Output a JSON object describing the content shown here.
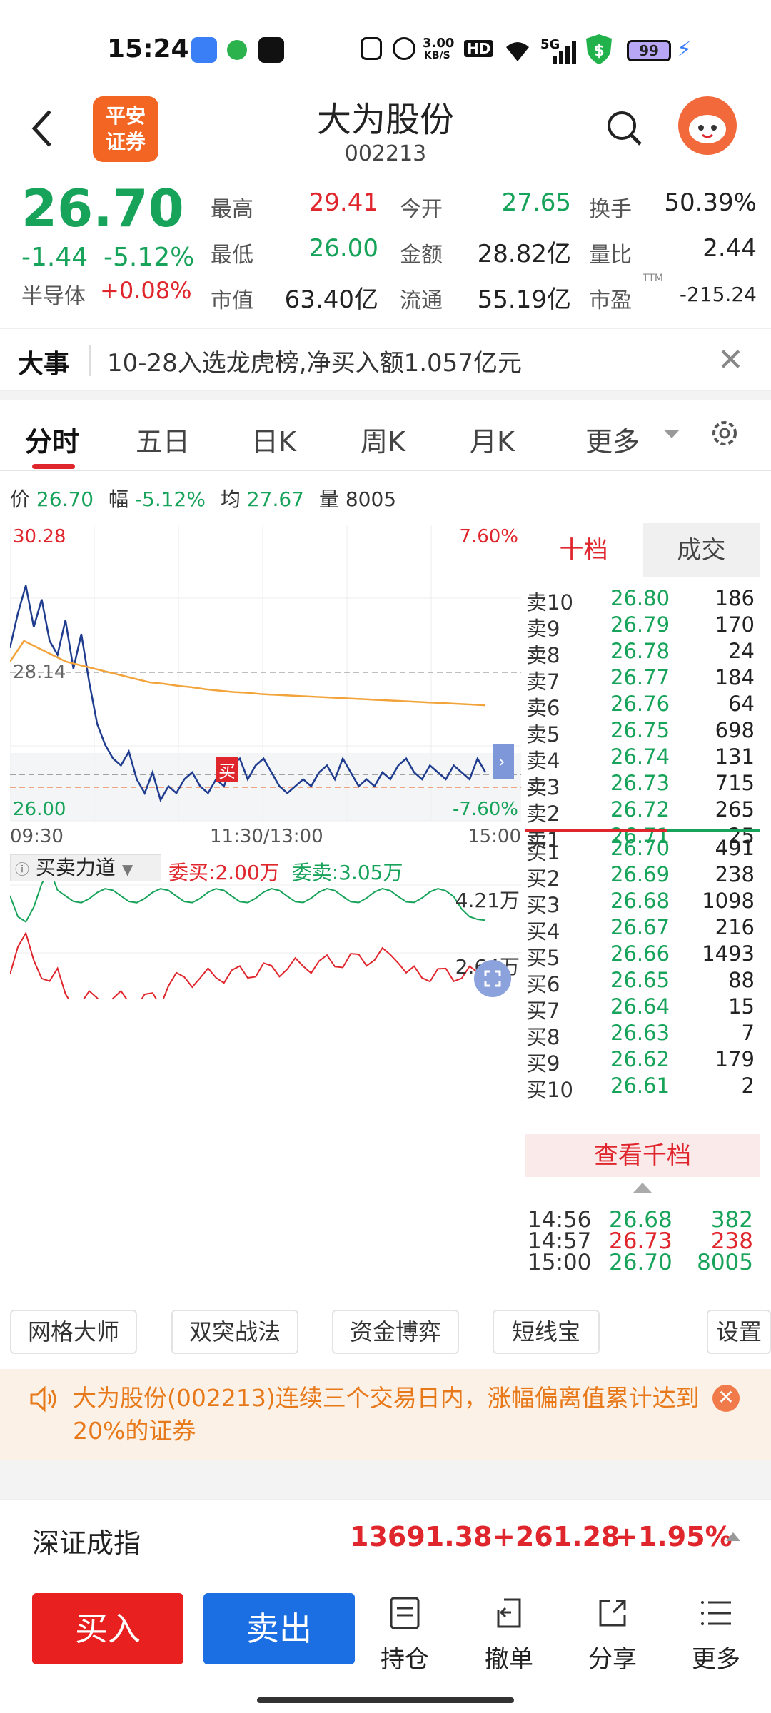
{
  "status_bar": {
    "time": "15:24",
    "net_speed_value": "3.00",
    "net_speed_unit": "KB/S",
    "hd": "HD",
    "signal": "5G",
    "battery": "99"
  },
  "header": {
    "logo_line1": "平安",
    "logo_line2": "证券",
    "stock_name": "大为股份",
    "stock_code": "002213"
  },
  "quote": {
    "price": "26.70",
    "change": "-1.44",
    "change_pct": "-5.12%",
    "sector_label": "半导体",
    "sector_pct": "+0.08%",
    "high_label": "最高",
    "high": "29.41",
    "low_label": "最低",
    "low": "26.00",
    "mcap_label": "市值",
    "mcap": "63.40亿",
    "open_label": "今开",
    "open": "27.65",
    "amount_label": "金额",
    "amount": "28.82亿",
    "float_label": "流通",
    "float": "55.19亿",
    "turnover_label": "换手",
    "turnover": "50.39%",
    "vol_ratio_label": "量比",
    "vol_ratio": "2.44",
    "pe_label": "市盈",
    "pe_sup": "TTM",
    "pe": "-215.24"
  },
  "news": {
    "tag": "大事",
    "text": "10-28入选龙虎榜,净买入额1.057亿元"
  },
  "tabs": [
    "分时",
    "五日",
    "日K",
    "周K",
    "月K",
    "更多"
  ],
  "info_line": {
    "price_label": "价",
    "price": "26.70",
    "amp_label": "幅",
    "amp": "-5.12%",
    "avg_label": "均",
    "avg": "27.67",
    "vol_label": "量",
    "vol": "8005"
  },
  "intraday": {
    "y_top": "30.28",
    "y_top_pct": "7.60%",
    "y_mid": "28.14",
    "y_bottom": "26.00",
    "y_bottom_pct": "-7.60%",
    "x_start": "09:30",
    "x_mid": "11:30/13:00",
    "x_end": "15:00",
    "buy_marker": "买",
    "indicator_name": "买卖力道",
    "bid_label": "委买:",
    "bid_value": "2.00万",
    "ask_label": "委卖:",
    "ask_value": "3.05万",
    "ind_top": "4.21万",
    "ind_mid": "2.64万"
  },
  "chart_data": {
    "type": "line",
    "title": "",
    "xlabel": "",
    "ylabel": "",
    "ylim": [
      26.0,
      30.28
    ],
    "x": [
      "09:30",
      "11:30/13:00",
      "15:00"
    ],
    "series": [
      {
        "name": "",
        "values": [
          28.5,
          29.0,
          29.4,
          28.8,
          29.2,
          28.6,
          28.4,
          28.9,
          28.2,
          28.7,
          28.0,
          27.4,
          27.1,
          26.9,
          26.8,
          27.0,
          26.6,
          26.4,
          26.7,
          26.3,
          26.5,
          26.4,
          26.6,
          26.7,
          26.5,
          26.4,
          26.6,
          26.5,
          26.8,
          26.9,
          26.6,
          26.8,
          26.9,
          26.7,
          26.5,
          26.4,
          26.5,
          26.6,
          26.5,
          26.7,
          26.8,
          26.6,
          26.9,
          26.7,
          26.5,
          26.6,
          26.5,
          26.7,
          26.6,
          26.8,
          26.9,
          26.7,
          26.6,
          26.8,
          26.7,
          26.6,
          26.8,
          26.7,
          26.6,
          26.9,
          26.7
        ]
      },
      {
        "name": "",
        "values": [
          28.3,
          28.6,
          28.5,
          28.4,
          28.3,
          28.25,
          28.2,
          28.15,
          28.1,
          28.05,
          28.0,
          27.98,
          27.95,
          27.93,
          27.9,
          27.88,
          27.86,
          27.85,
          27.83,
          27.82,
          27.81,
          27.8,
          27.79,
          27.78,
          27.77,
          27.76,
          27.75,
          27.74,
          27.73,
          27.72,
          27.71,
          27.7,
          27.69,
          27.68,
          27.67
        ]
      }
    ]
  },
  "order_book": {
    "tab_active": "十档",
    "tab_other": "成交",
    "asks": [
      {
        "label": "卖10",
        "price": "26.80",
        "vol": "186"
      },
      {
        "label": "卖9",
        "price": "26.79",
        "vol": "170"
      },
      {
        "label": "卖8",
        "price": "26.78",
        "vol": "24"
      },
      {
        "label": "卖7",
        "price": "26.77",
        "vol": "184"
      },
      {
        "label": "卖6",
        "price": "26.76",
        "vol": "64"
      },
      {
        "label": "卖5",
        "price": "26.75",
        "vol": "698"
      },
      {
        "label": "卖4",
        "price": "26.74",
        "vol": "131"
      },
      {
        "label": "卖3",
        "price": "26.73",
        "vol": "715"
      },
      {
        "label": "卖2",
        "price": "26.72",
        "vol": "265"
      },
      {
        "label": "卖1",
        "price": "26.71",
        "vol": "25"
      }
    ],
    "bids": [
      {
        "label": "买1",
        "price": "26.70",
        "vol": "491"
      },
      {
        "label": "买2",
        "price": "26.69",
        "vol": "238"
      },
      {
        "label": "买3",
        "price": "26.68",
        "vol": "1098"
      },
      {
        "label": "买4",
        "price": "26.67",
        "vol": "216"
      },
      {
        "label": "买5",
        "price": "26.66",
        "vol": "1493"
      },
      {
        "label": "买6",
        "price": "26.65",
        "vol": "88"
      },
      {
        "label": "买7",
        "price": "26.64",
        "vol": "15"
      },
      {
        "label": "买8",
        "price": "26.63",
        "vol": "7"
      },
      {
        "label": "买9",
        "price": "26.62",
        "vol": "179"
      },
      {
        "label": "买10",
        "price": "26.61",
        "vol": "2"
      }
    ],
    "view_more": "查看千档",
    "ticks": [
      {
        "time": "14:56",
        "price": "26.68",
        "vol": "382"
      },
      {
        "time": "14:57",
        "price": "26.73",
        "vol": "238"
      },
      {
        "time": "15:00",
        "price": "26.70",
        "vol": "8005"
      }
    ]
  },
  "tools": [
    "网格大师",
    "双突战法",
    "资金博弈",
    "短线宝",
    "设置"
  ],
  "warning": {
    "text": "大为股份(002213)连续三个交易日内，涨幅偏离值累计达到20%的证券"
  },
  "index_bar": {
    "name": "深证成指",
    "value": "13691.38",
    "change": "+261.28",
    "change_pct": "+1.95%"
  },
  "bottom_nav": {
    "buy": "买入",
    "sell": "卖出",
    "items": [
      "持仓",
      "撤单",
      "分享",
      "更多"
    ]
  },
  "colors": {
    "up": "#e0262d",
    "down": "#17a35a",
    "price_line": "#1f3c8f",
    "avg_line": "#f2a33a"
  }
}
